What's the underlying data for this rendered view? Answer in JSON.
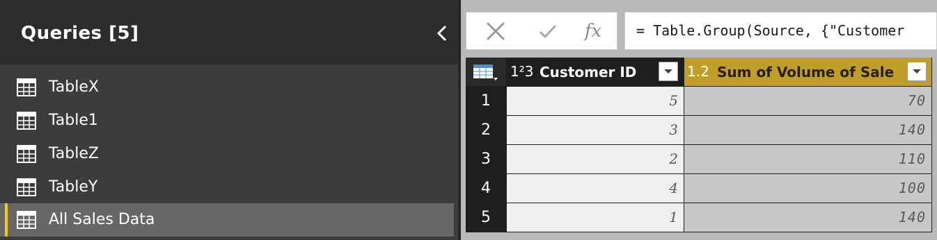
{
  "queries_pane": {
    "title": "Queries [5]",
    "items": [
      {
        "label": "TableX",
        "selected": false
      },
      {
        "label": "Table1",
        "selected": false
      },
      {
        "label": "TableZ",
        "selected": false
      },
      {
        "label": "TableY",
        "selected": false
      },
      {
        "label": "All Sales Data",
        "selected": true
      }
    ]
  },
  "formula_bar": {
    "cancel_icon": "x-icon",
    "confirm_icon": "check-icon",
    "fx_label": "fx",
    "formula": "= Table.Group(Source, {\"Customer"
  },
  "grid": {
    "columns": [
      {
        "type_badge": "1²3",
        "name": "Customer ID",
        "selected": false
      },
      {
        "type_badge": "1.2",
        "name": "Sum of Volume of Sale",
        "selected": true
      }
    ],
    "rows": [
      {
        "num": "1",
        "customer_id": "5",
        "sum_volume": "70"
      },
      {
        "num": "2",
        "customer_id": "3",
        "sum_volume": "140"
      },
      {
        "num": "3",
        "customer_id": "2",
        "sum_volume": "110"
      },
      {
        "num": "4",
        "customer_id": "4",
        "sum_volume": "100"
      },
      {
        "num": "5",
        "customer_id": "1",
        "sum_volume": "140"
      }
    ]
  },
  "colors": {
    "accent": "#f2c811",
    "selected_column": "#c29d29",
    "pane_bg": "#3c3c3c"
  }
}
